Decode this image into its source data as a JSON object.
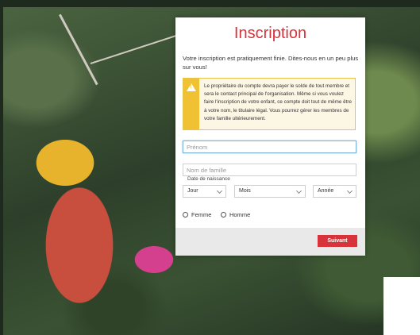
{
  "form": {
    "title": "Inscription",
    "intro": "Votre inscription est pratiquement finie. Dites-nous en un peu plus sur vous!",
    "warning": "Le propriétaire du compte devra payer le solde de tout membre et sera le contact principal de l'organisation. Même si vous voulez faire l'inscription de votre enfant, ce compte doit tout de même être à votre nom, le titulaire légal. Vous pourrez gérer les membres de votre famille ultérieurement.",
    "firstname_placeholder": "Prénom",
    "lastname_placeholder": "Nom de famille",
    "dob_label": "Date de naissance",
    "day": "Jour",
    "month": "Mois",
    "year": "Année",
    "gender_female": "Femme",
    "gender_male": "Homme",
    "next_label": "Suivant"
  },
  "icons": {
    "warning": "warning-icon",
    "dropdown": "chevron-down-icon"
  },
  "colors": {
    "accent": "#d8333b",
    "warning": "#f0c233"
  }
}
